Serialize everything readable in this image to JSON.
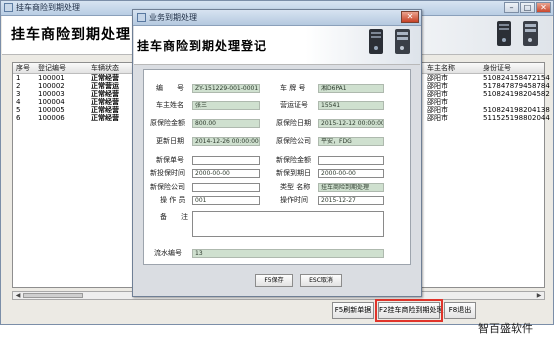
{
  "window": {
    "title": "挂车商险到期处理",
    "header": "挂车商险到期处理"
  },
  "grid": {
    "columns": [
      "序号",
      "登记编号",
      "车辆状态",
      "车主名称",
      "身份证号"
    ],
    "rows": [
      {
        "no": "1",
        "reg": "100001",
        "status": "正常经营",
        "owner": "邵阳市",
        "id": "510824158472154"
      },
      {
        "no": "2",
        "reg": "100002",
        "status": "正常营运",
        "owner": "邵阳市",
        "id": "517847879458784"
      },
      {
        "no": "3",
        "reg": "100003",
        "status": "正常经营",
        "owner": "邵阳市",
        "id": "510824198204582"
      },
      {
        "no": "4",
        "reg": "100004",
        "status": "正常经营",
        "owner": "邵阳市",
        "id": ""
      },
      {
        "no": "5",
        "reg": "100005",
        "status": "正常经营",
        "owner": "邵阳市",
        "id": "510824198204138"
      },
      {
        "no": "6",
        "reg": "100006",
        "status": "正常经营",
        "owner": "邵阳市",
        "id": "511525198802044"
      }
    ]
  },
  "bottom_buttons": {
    "refresh": "F5刷新单据",
    "process": "F2挂车商险到期处理",
    "exit": "F8退出"
  },
  "watermark": "智百盛软件",
  "dialog": {
    "title": "业务到期处理",
    "header": "挂车商险到期处理登记",
    "fields": {
      "serial": {
        "label": "编　　号",
        "value": "ZY-151229-001-0001"
      },
      "plate": {
        "label": "车 牌 号",
        "value": "湘D6PA1"
      },
      "owner": {
        "label": "车主姓名",
        "value": "张三"
      },
      "license": {
        "label": "营运证号",
        "value": "15541"
      },
      "orig_amount": {
        "label": "原保险金额",
        "value": "800.00"
      },
      "orig_date": {
        "label": "原保险日期",
        "value": "2015-12-12 00:00:00"
      },
      "new_date": {
        "label": "更新日期",
        "value": "2014-12-26 00:00:00"
      },
      "orig_company": {
        "label": "原保险公司",
        "value": "平安，FDG"
      },
      "new_number": {
        "label": "新保单号",
        "value": ""
      },
      "new_amount": {
        "label": "新保险金额",
        "value": ""
      },
      "new_start": {
        "label": "新投保时间",
        "value": "2000-00-00"
      },
      "new_expire": {
        "label": "新保到期日",
        "value": "2000-00-00"
      },
      "new_company": {
        "label": "新保险公司",
        "value": ""
      },
      "business": {
        "label": "类型 名称",
        "value": "挂车商险到期处理"
      },
      "operator": {
        "label": "操 作 员",
        "value": "001"
      },
      "op_time": {
        "label": "操作时间",
        "value": "2015-12-27"
      },
      "remark": {
        "label": "备　　注",
        "value": ""
      },
      "apply_no": {
        "label": "流水编号",
        "value": "13"
      }
    },
    "buttons": {
      "save": "F5保存",
      "cancel": "ESC取消"
    }
  }
}
